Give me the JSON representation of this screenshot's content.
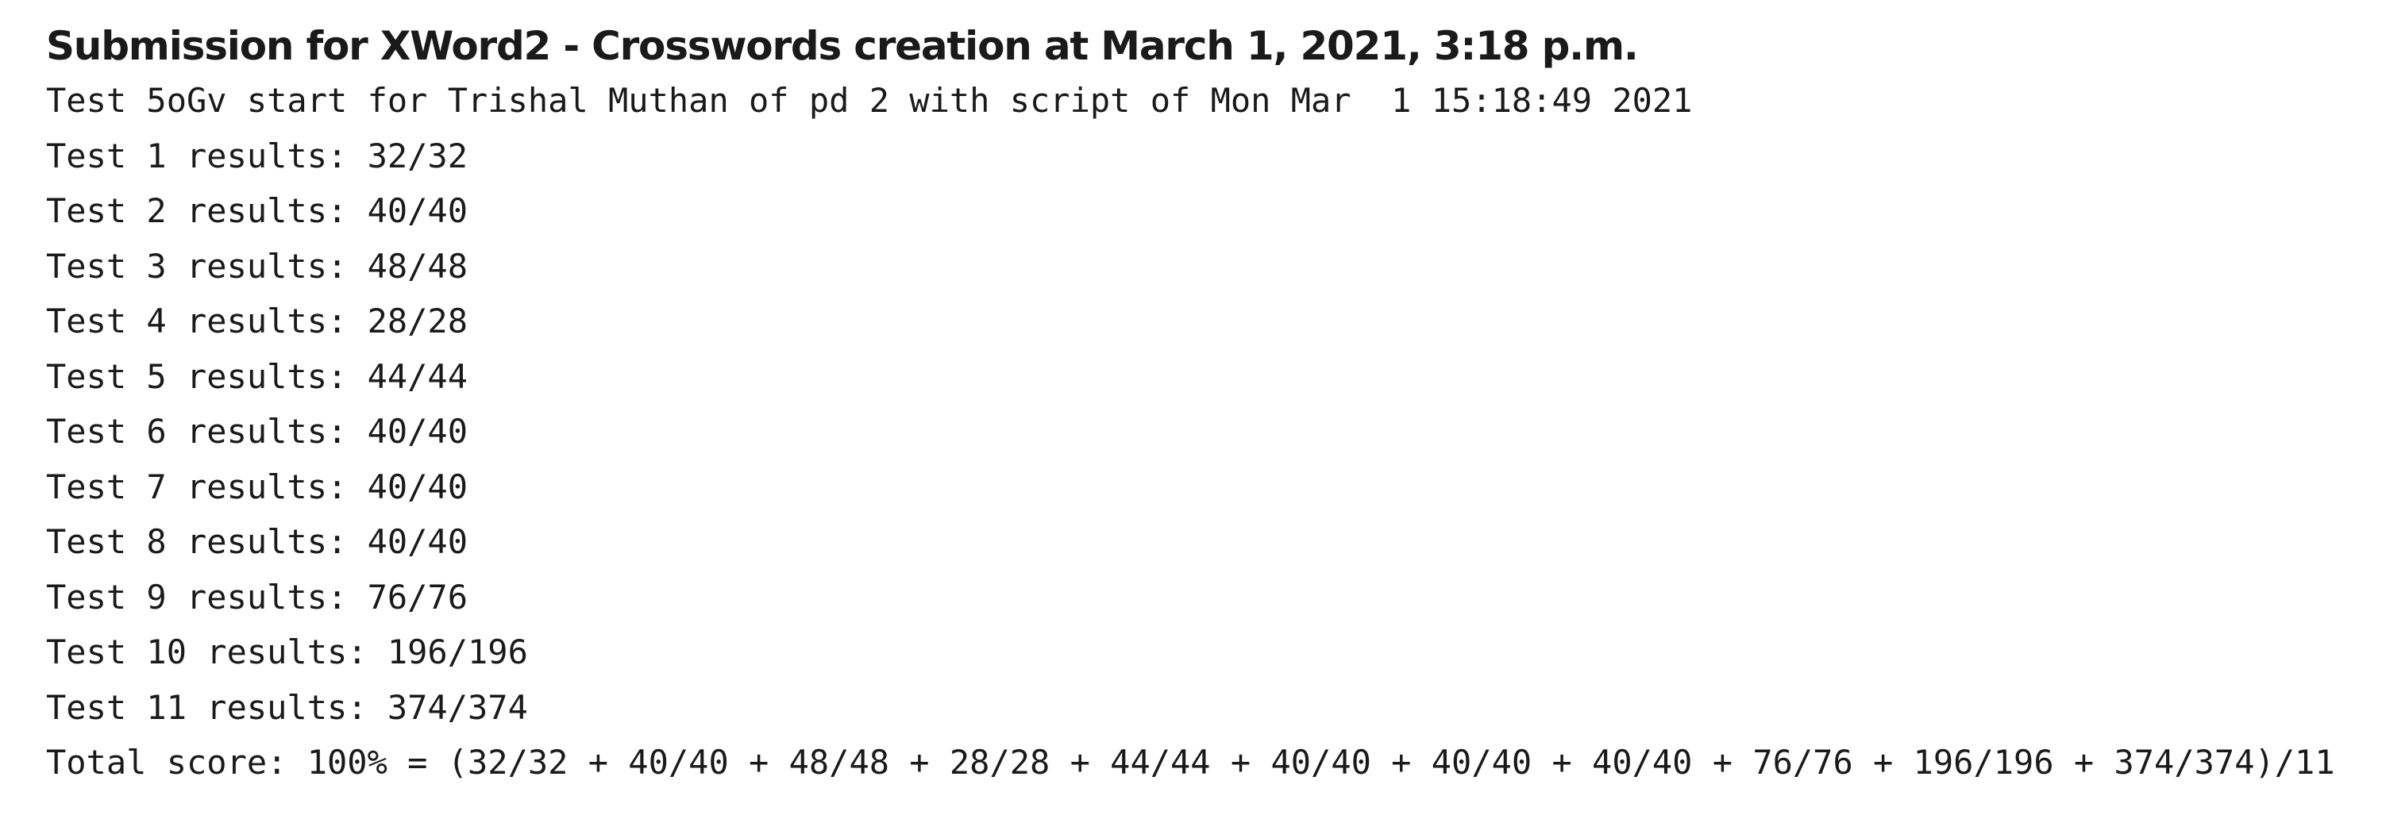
{
  "submission": {
    "title": "Submission for XWord2 - Crosswords creation at March 1, 2021, 3:18 p.m.",
    "header_line": "Test 5oGv start for Trishal Muthan of pd 2 with script of Mon Mar  1 15:18:49 2021",
    "results": [
      "Test 1 results: 32/32",
      "Test 2 results: 40/40",
      "Test 3 results: 48/48",
      "Test 4 results: 28/28",
      "Test 5 results: 44/44",
      "Test 6 results: 40/40",
      "Test 7 results: 40/40",
      "Test 8 results: 40/40",
      "Test 9 results: 76/76",
      "Test 10 results: 196/196",
      "Test 11 results: 374/374"
    ],
    "total_line": "Total score: 100% = (32/32 + 40/40 + 48/48 + 28/28 + 44/44 + 40/40 + 40/40 + 40/40 + 76/76 + 196/196 + 374/374)/11"
  }
}
